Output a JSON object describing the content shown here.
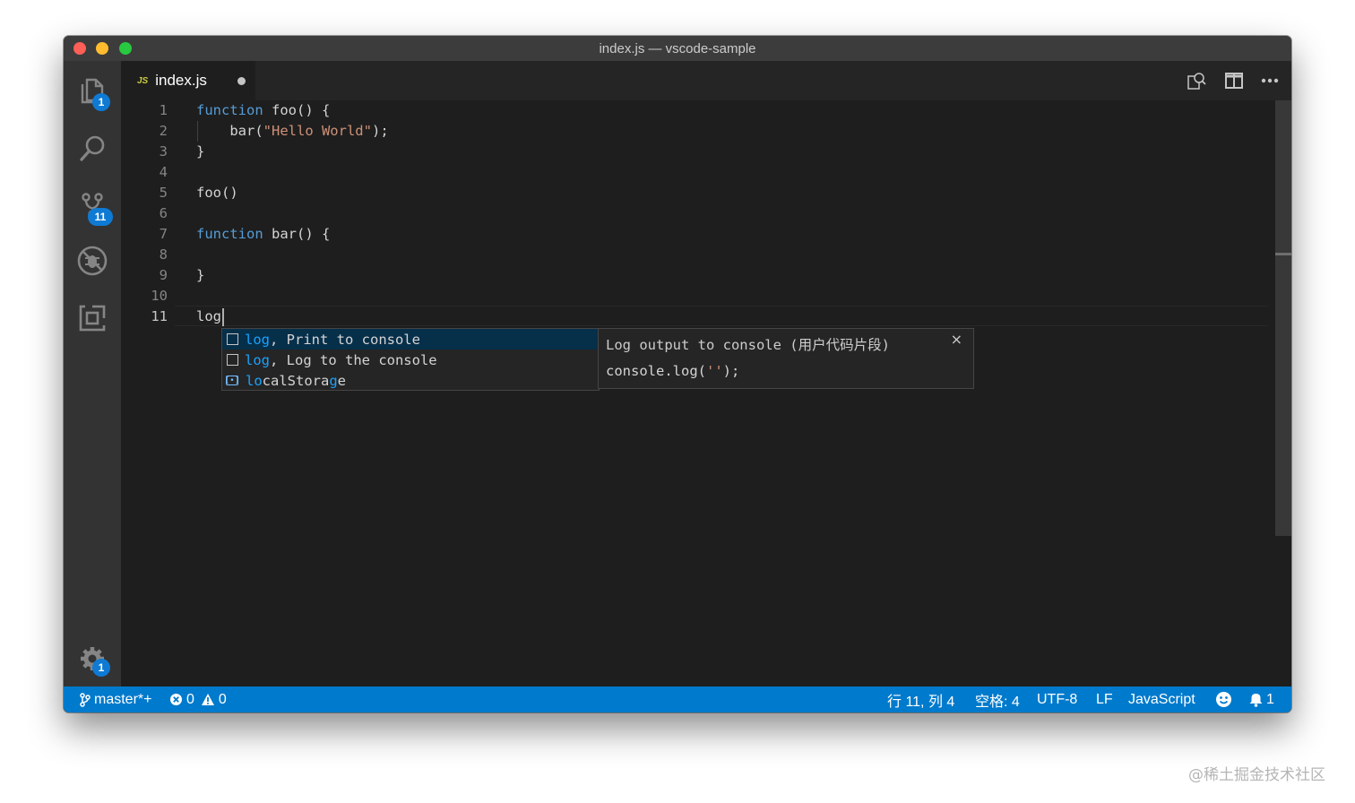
{
  "window": {
    "title": "index.js — vscode-sample"
  },
  "activity_bar": {
    "explorer_badge": "1",
    "source_control_badge": "11",
    "settings_badge": "1"
  },
  "tab": {
    "icon_label": "JS",
    "file_name": "index.js"
  },
  "editor": {
    "line_numbers": [
      "1",
      "2",
      "3",
      "4",
      "5",
      "6",
      "7",
      "8",
      "9",
      "10",
      "11"
    ],
    "lines": {
      "l1_kw": "function",
      "l1_rest": " foo() {",
      "l2_pre": "    bar(",
      "l2_str": "\"Hello World\"",
      "l2_post": ");",
      "l3": "}",
      "l5": "foo()",
      "l7_kw": "function",
      "l7_rest": " bar() {",
      "l9": "}",
      "l11": "log"
    }
  },
  "suggest": {
    "items": [
      {
        "match": "log",
        "rest": ", Print to console"
      },
      {
        "match": "log",
        "rest": ", Log to the console"
      },
      {
        "match_a": "lo",
        "mid": "calStora",
        "match_b": "g",
        "end": "e"
      }
    ]
  },
  "details": {
    "title": "Log output to console (用户代码片段)",
    "code_pre": "console.log(",
    "code_str": "''",
    "code_post": ");",
    "close": "×"
  },
  "status_bar": {
    "branch": "master*+",
    "errors": "0",
    "warnings": "0",
    "position": "行 11, 列 4",
    "spaces": "空格: 4",
    "encoding": "UTF-8",
    "eol": "LF",
    "language": "JavaScript",
    "notifications": "1"
  },
  "watermark": "@稀土掘金技术社区",
  "colors": {
    "accent": "#007acc",
    "keyword": "#569cd6",
    "string": "#ce9178",
    "match_highlight": "#18a3ff"
  }
}
